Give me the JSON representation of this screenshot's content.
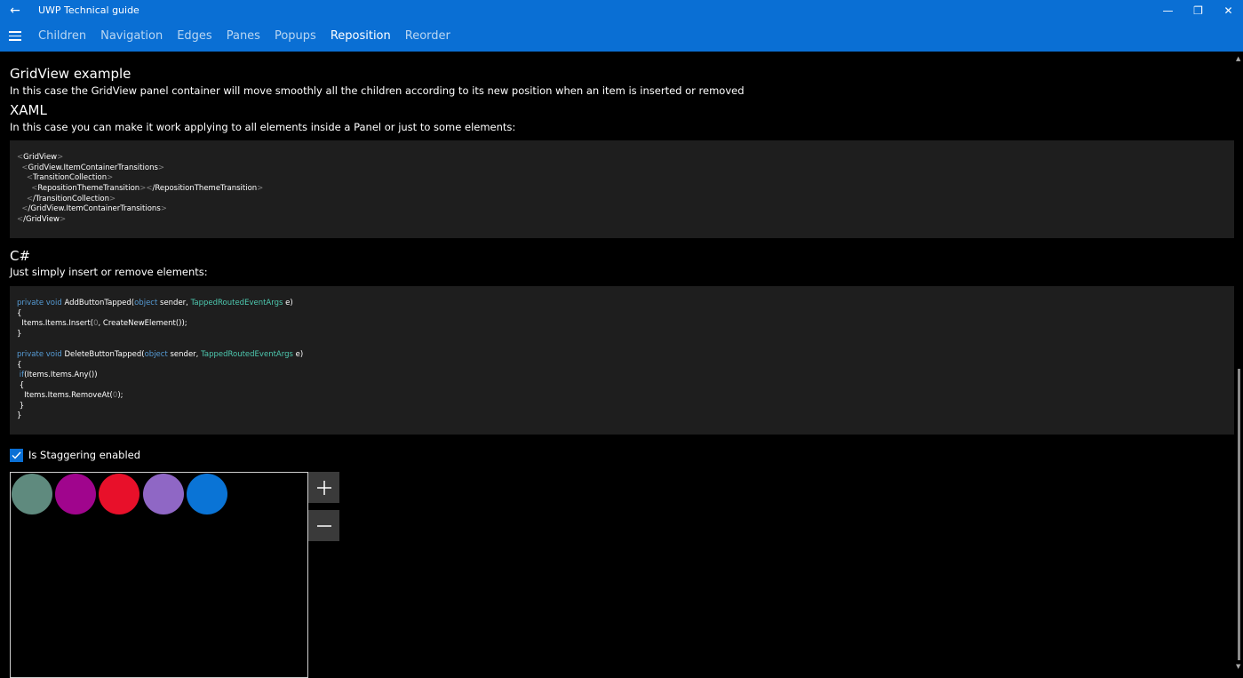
{
  "app": {
    "title": "UWP Technical guide",
    "back_glyph": "←"
  },
  "window_controls": {
    "minimize": "—",
    "maximize": "❐",
    "close": "✕"
  },
  "nav": {
    "tabs": [
      {
        "label": "Children"
      },
      {
        "label": "Navigation"
      },
      {
        "label": "Edges"
      },
      {
        "label": "Panes"
      },
      {
        "label": "Popups"
      },
      {
        "label": "Reposition",
        "active": true
      },
      {
        "label": "Reorder"
      }
    ]
  },
  "sections": {
    "gridview_title": "GridView example",
    "gridview_desc": "In this case the GridView panel container will move smoothly all the children according to its new position when an item is inserted or removed",
    "xaml_title": "XAML",
    "xaml_desc": "In this case you can make it work applying to all elements inside a Panel or just to some elements:",
    "csharp_title": "C#",
    "csharp_desc": "Just simply insert or remove elements:"
  },
  "xaml_code": {
    "l1": "GridView",
    "l2": "GridView.ItemContainerTransitions",
    "l3": "TransitionCollection",
    "l4a": "RepositionThemeTransition",
    "l4b": "/RepositionThemeTransition",
    "l5": "/TransitionCollection",
    "l6": "/GridView.ItemContainerTransitions",
    "l7": "/GridView"
  },
  "csharp_code": {
    "kw_private_void": "private void",
    "add_method": "AddButtonTapped(",
    "kw_object": "object",
    "sender": " sender, ",
    "args_type": "TappedRoutedEventArgs",
    "args_end": " e)",
    "open_brace": "{",
    "close_brace": "}",
    "insert_pre": "Items.Items.Insert(",
    "insert_zero": "0",
    "insert_post": ", CreateNewElement());",
    "delete_method": "DeleteButtonTapped(",
    "kw_if": "if",
    "if_cond": "(Items.Items.Any())",
    "remove_pre": "Items.Items.RemoveAt(",
    "remove_zero": "0",
    "remove_post": ");"
  },
  "stagger": {
    "label": "Is Staggering enabled",
    "checked": true
  },
  "circles": [
    {
      "color": "#5f8a7e"
    },
    {
      "color": "#a0058d"
    },
    {
      "color": "#e8102a"
    },
    {
      "color": "#8f67c5"
    },
    {
      "color": "#0a74d6"
    }
  ],
  "buttons": {
    "add_glyph": "+",
    "remove_glyph": "—"
  }
}
